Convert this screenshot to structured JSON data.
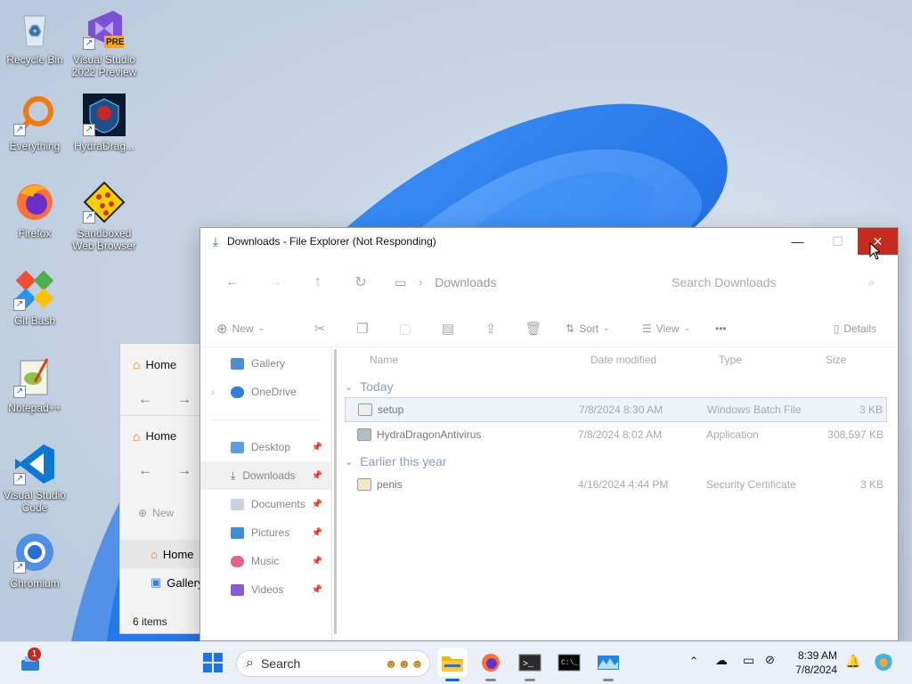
{
  "desktop": {
    "icons": [
      {
        "label": "Recycle Bin"
      },
      {
        "label": "Visual Studio 2022 Preview",
        "badge": "PRE"
      },
      {
        "label": "Everything"
      },
      {
        "label": "HydraDrag..."
      },
      {
        "label": "Firefox"
      },
      {
        "label": "Sandboxed Web Browser"
      },
      {
        "label": "Git Bash"
      },
      {
        "label": "Notepad++"
      },
      {
        "label": "Visual Studio Code"
      },
      {
        "label": "Chromium"
      }
    ]
  },
  "back_window": {
    "tab1": "Home",
    "tab2": "Home",
    "new_label": "New",
    "nav_home": "Home",
    "nav_gallery": "Gallery",
    "status": "6 items"
  },
  "window": {
    "title": "Downloads - File Explorer (Not Responding)",
    "address": "Downloads",
    "search_placeholder": "Search Downloads",
    "toolbar": {
      "new": "New",
      "sort": "Sort",
      "view": "View",
      "more": "•••",
      "details": "Details"
    },
    "nav": [
      {
        "label": "Gallery",
        "color": "#4a8fd6"
      },
      {
        "label": "OneDrive",
        "color": "#2f7fd8"
      },
      {
        "label": "Desktop",
        "color": "#5aa0e0"
      },
      {
        "label": "Downloads",
        "color": "#2e9a52"
      },
      {
        "label": "Documents",
        "color": "#7f8fa6"
      },
      {
        "label": "Pictures",
        "color": "#3d8fd6"
      },
      {
        "label": "Music",
        "color": "#e0648a"
      },
      {
        "label": "Videos",
        "color": "#8a5ad8"
      }
    ],
    "columns": {
      "name": "Name",
      "date": "Date modified",
      "type": "Type",
      "size": "Size"
    },
    "groups": [
      {
        "label": "Today",
        "files": [
          {
            "name": "setup",
            "date": "7/8/2024 8:30 AM",
            "type": "Windows Batch File",
            "size": "3 KB"
          },
          {
            "name": "HydraDragonAntivirus",
            "date": "7/8/2024 8:02 AM",
            "type": "Application",
            "size": "308,597 KB"
          }
        ]
      },
      {
        "label": "Earlier this year",
        "files": [
          {
            "name": "penis",
            "date": "4/16/2024 4:44 PM",
            "type": "Security Certificate",
            "size": "3 KB"
          }
        ]
      }
    ]
  },
  "taskbar": {
    "search_label": "Search",
    "notification_count": "1",
    "time": "8:39 AM",
    "date": "7/8/2024",
    "accent": "#1866d4"
  }
}
